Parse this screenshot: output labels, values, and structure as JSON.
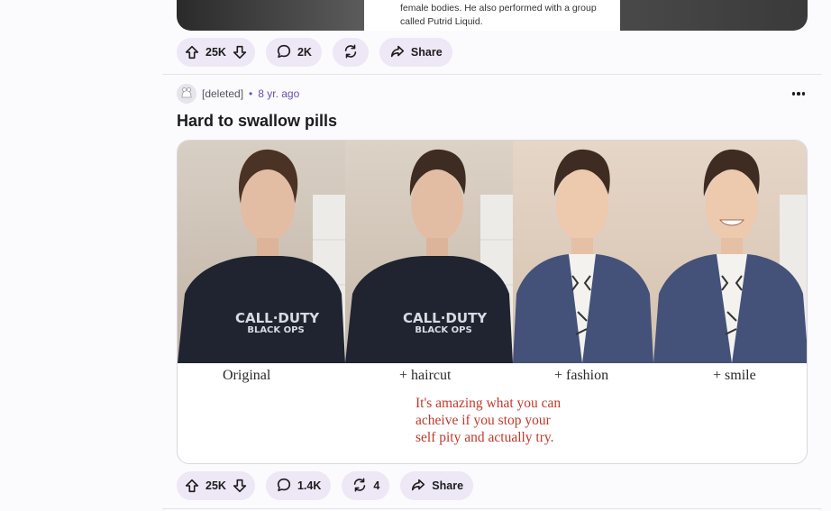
{
  "previous_post": {
    "caption_lines": [
      "female bodies. He also performed with a group",
      "called Putrid Liquid."
    ],
    "actions": {
      "votes": "25K",
      "comments": "2K",
      "share_label": "Share"
    }
  },
  "post": {
    "author": "[deleted]",
    "separator": "•",
    "age": "8 yr. ago",
    "title": "Hard to swallow pills",
    "image": {
      "panel_labels": [
        "Original",
        "+ haircut",
        "+ fashion",
        "+ smile"
      ],
      "shirt_text": [
        "CALL·DUTY",
        "BLACK OPS"
      ],
      "quote_lines": [
        "It's amazing what you can",
        "acheive if you stop your",
        "self pity and actually try."
      ]
    },
    "actions": {
      "votes": "25K",
      "comments": "1.4K",
      "crossposts": "4",
      "share_label": "Share"
    }
  },
  "colors": {
    "pill_bg": "#ede7f6",
    "meta_accent": "#6b4fa8",
    "quote_red": "#c0392b"
  },
  "icons": [
    "upvote-icon",
    "downvote-icon",
    "comment-icon",
    "crosspost-icon",
    "share-icon",
    "more-options-icon",
    "avatar-icon"
  ]
}
